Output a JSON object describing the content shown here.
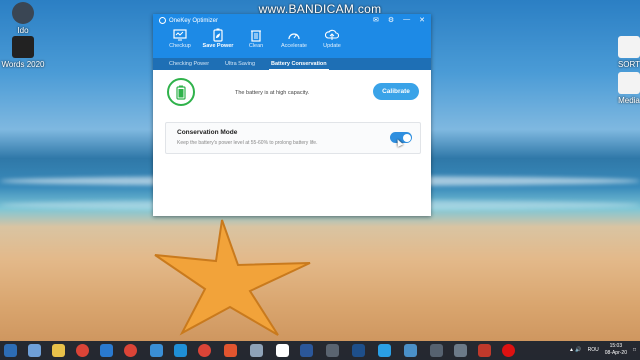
{
  "watermark": "www.BANDICAM.com",
  "desktop": {
    "left_icons": [
      {
        "label": "Ido",
        "icon": "recycle-bin-icon"
      },
      {
        "label": "Words 2020",
        "icon": "folder-icon"
      }
    ],
    "right_icons": [
      {
        "label": "SORT",
        "icon": "file-icon"
      },
      {
        "label": "Media",
        "icon": "file-icon"
      }
    ]
  },
  "window": {
    "title": "OneKey Optimizer",
    "toolbar": [
      {
        "label": "Checkup",
        "icon": "monitor-icon"
      },
      {
        "label": "Save Power",
        "icon": "battery-leaf-icon",
        "active": true
      },
      {
        "label": "Clean",
        "icon": "trash-icon"
      },
      {
        "label": "Accelerate",
        "icon": "speedometer-icon"
      },
      {
        "label": "Update",
        "icon": "cloud-upload-icon"
      }
    ],
    "tabs": [
      "Checking Power",
      "Ultra Saving",
      "Battery Conservation"
    ],
    "active_tab": "Battery Conservation",
    "status_text": "The battery is at high capacity.",
    "calibrate_label": "Calibrate",
    "conservation": {
      "title": "Conservation Mode",
      "description": "Keep the battery's power level at 55-60% to prolong battery life.",
      "enabled": true
    }
  },
  "taskbar": {
    "lang": "ROU",
    "time": "15:03",
    "date": "08-Apr-20"
  },
  "colors": {
    "accent": "#1d8ae6",
    "tabbar": "#1e6fb5",
    "battery_green": "#2fb24b",
    "button": "#3aa3e8"
  }
}
